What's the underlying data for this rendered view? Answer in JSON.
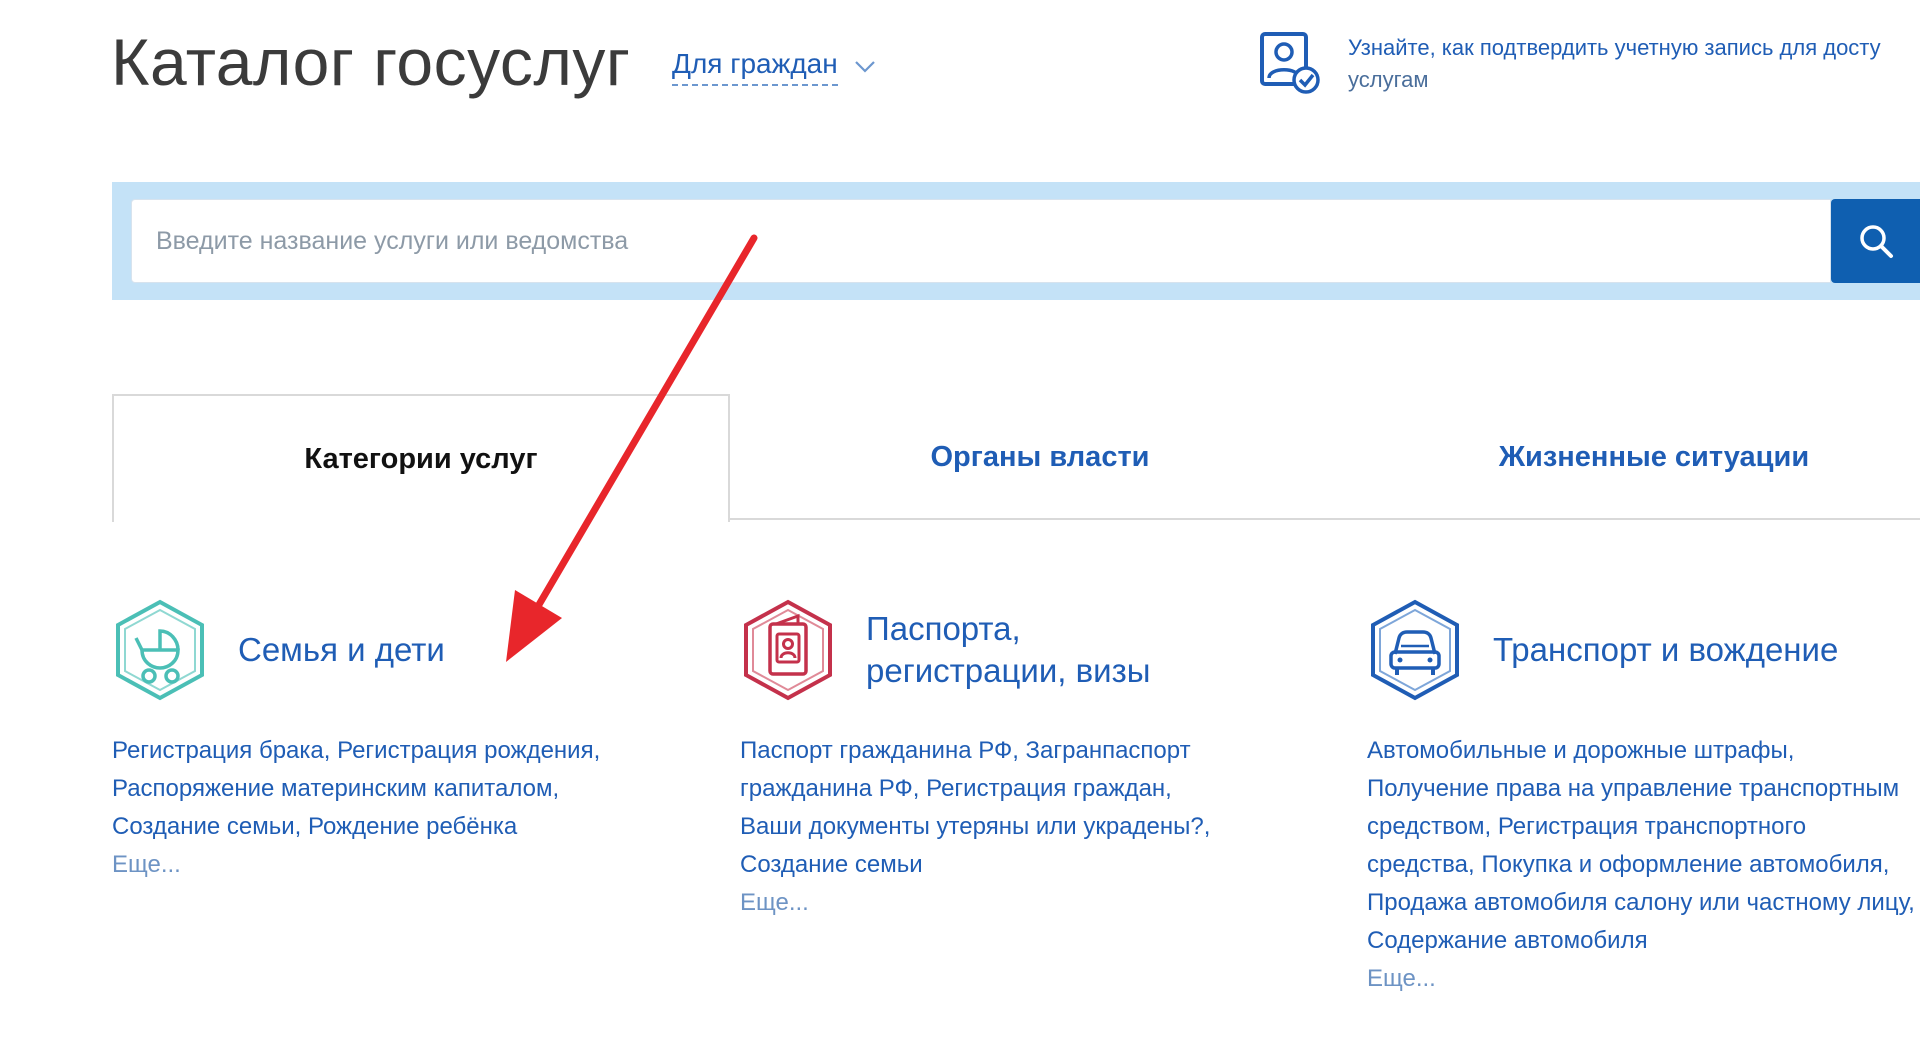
{
  "header": {
    "title": "Каталог госуслуг",
    "audience": "Для граждан",
    "verify_line1": "Узнайте, как подтвердить учетную запись для досту",
    "verify_line2": "услугам"
  },
  "search": {
    "placeholder": "Введите название услуги или ведомства"
  },
  "tabs": [
    {
      "label": "Категории услуг",
      "active": true
    },
    {
      "label": "Органы власти",
      "active": false
    },
    {
      "label": "Жизненные ситуации",
      "active": false
    }
  ],
  "categories": [
    {
      "icon": "stroller-icon",
      "color": "#4bbfb6",
      "title": "Семья и дети",
      "links": [
        "Регистрация брака,",
        "Регистрация рождения,",
        "Распоряжение материнским капиталом,",
        "Создание семьи,",
        "Рождение ребёнка"
      ],
      "more": "Еще..."
    },
    {
      "icon": "passport-icon",
      "color": "#c4314b",
      "title_line1": "Паспорта,",
      "title_line2": "регистрации, визы",
      "links": [
        "Паспорт гражданина РФ,",
        "Загранпаспорт гражданина РФ,",
        "Регистрация граждан,",
        "Ваши документы утеряны или украдены?,",
        "Создание семьи"
      ],
      "more": "Еще..."
    },
    {
      "icon": "car-icon",
      "color": "#1f5db5",
      "title": "Транспорт и вождение",
      "links": [
        "Автомобильные и дорожные штрафы,",
        "Получение права на управление транспортным средством,",
        "Регистрация транспортного средства,",
        "Покупка и оформление автомобиля,",
        "Продажа автомобиля салону или частному лицу,",
        "Содержание автомобиля"
      ],
      "more": "Еще..."
    }
  ],
  "colors": {
    "link": "#1f5db5",
    "search_band": "#c4e2f7",
    "search_button": "#0f5fb0",
    "annotation_arrow": "#e8262b"
  }
}
